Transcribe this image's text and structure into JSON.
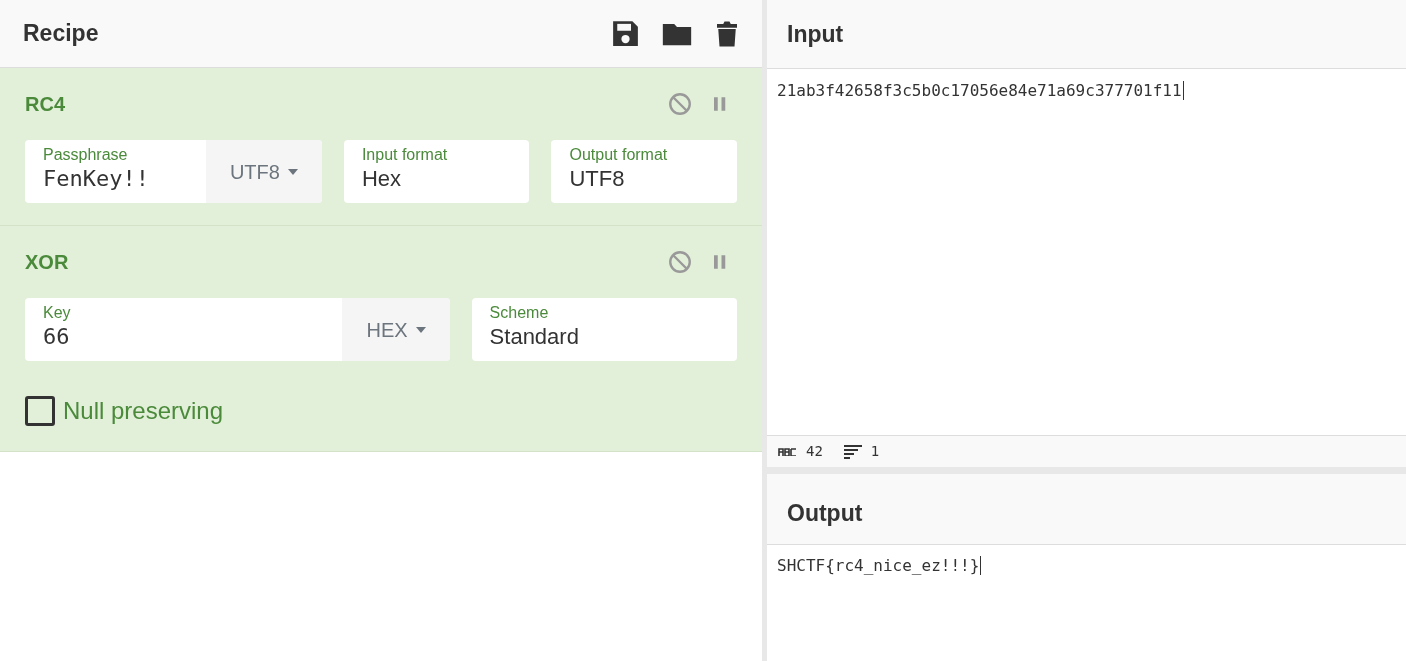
{
  "recipe": {
    "title": "Recipe",
    "operations": [
      {
        "name": "RC4",
        "args": [
          {
            "kind": "text",
            "label": "Passphrase",
            "value": "FenKey!!",
            "dropdown": "UTF8"
          },
          {
            "kind": "select",
            "label": "Input format",
            "value": "Hex"
          },
          {
            "kind": "select",
            "label": "Output format",
            "value": "UTF8"
          }
        ]
      },
      {
        "name": "XOR",
        "args": [
          {
            "kind": "text",
            "label": "Key",
            "value": "66",
            "dropdown": "HEX"
          },
          {
            "kind": "select",
            "label": "Scheme",
            "value": "Standard"
          },
          {
            "kind": "checkbox",
            "label": "Null preserving",
            "checked": false
          }
        ]
      }
    ]
  },
  "input": {
    "title": "Input",
    "text": "21ab3f42658f3c5b0c17056e84e71a69c377701f11",
    "length": "42",
    "lines": "1"
  },
  "output": {
    "title": "Output",
    "text": "SHCTF{rc4_nice_ez!!!}"
  }
}
